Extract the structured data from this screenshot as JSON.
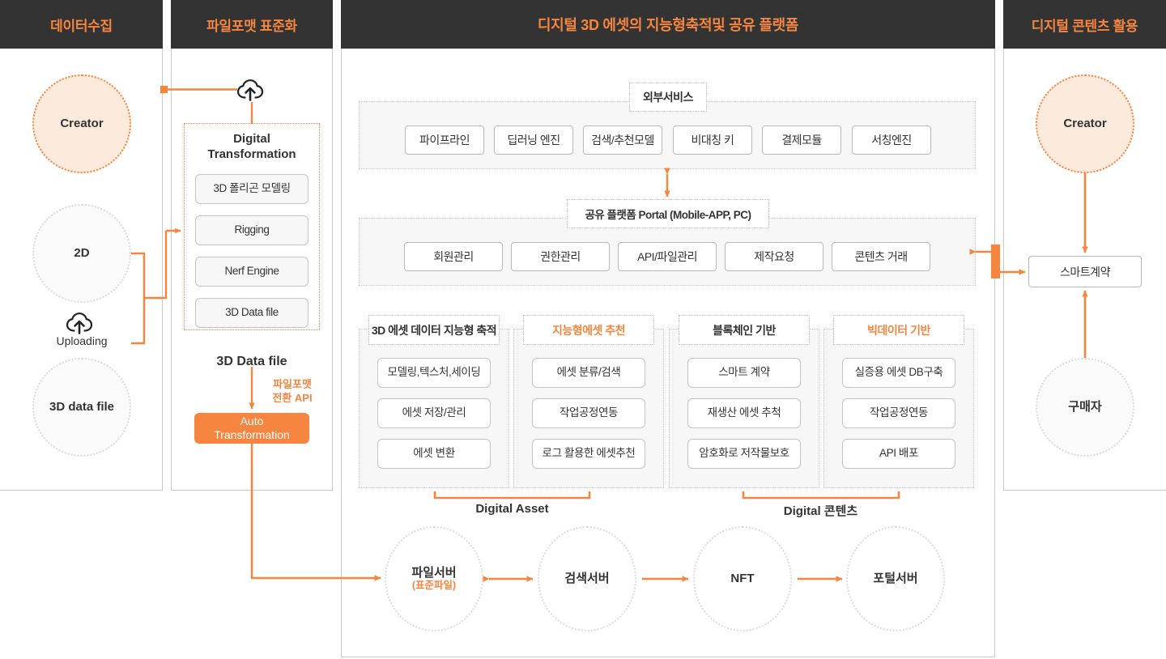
{
  "columns": {
    "collect": {
      "title": "데이터수집"
    },
    "standard": {
      "title": "파일포맷 표준화"
    },
    "platform": {
      "title": "디지털 3D 에셋의 지능형축적및 공유 플랫폼"
    },
    "utilize": {
      "title": "디지털 콘텐츠 활용"
    }
  },
  "collect": {
    "creator": "Creator",
    "twod": "2D",
    "upload_label": "Uploading",
    "threed": "3D data file"
  },
  "standard": {
    "dt_title_line1": "Digital",
    "dt_title_line2": "Transformation",
    "dt_items": [
      "3D 폴리곤 모델링",
      "Rigging",
      "Nerf Engine",
      "3D Data file"
    ],
    "datafile_label": "3D Data file",
    "api_label_line1": "파일포맷",
    "api_label_line2": "전환 API",
    "auto_line1": "Auto",
    "auto_line2": "Transformation"
  },
  "platform": {
    "external": {
      "title": "외부서비스",
      "items": [
        "파이프라인",
        "딥러닝 엔진",
        "검색/추천모델",
        "비대칭 키",
        "결제모듈",
        "서칭엔진"
      ]
    },
    "portal": {
      "title": "공유 플랫폼 Portal (Mobile-APP, PC)",
      "items": [
        "회원관리",
        "권한관리",
        "API/파일관리",
        "제작요청",
        "콘텐츠 거래"
      ]
    },
    "groups": [
      {
        "title": "3D 에셋 데이터 지능형 축적",
        "accent": false,
        "items": [
          "모델링,텍스처,세이딩",
          "에셋 저장/관리",
          "에셋 변환"
        ]
      },
      {
        "title": "지능형에셋 추천",
        "accent": true,
        "items": [
          "에셋 분류/검색",
          "작업공정연동",
          "로그 활용한 에셋추천"
        ]
      },
      {
        "title": "블록체인 기반",
        "accent": false,
        "items": [
          "스마트 계약",
          "재생산 에셋 추척",
          "암호화로 저작물보호"
        ]
      },
      {
        "title": "빅데이터 기반",
        "accent": true,
        "items": [
          "실증용 에셋 DB구축",
          "작업공정연동",
          "API 배포"
        ]
      }
    ],
    "brackets": [
      {
        "label": "Digital Asset"
      },
      {
        "label": "Digital 콘텐츠"
      }
    ],
    "servers": [
      {
        "label": "파일서버",
        "sub": "(표준파일)"
      },
      {
        "label": "검색서버",
        "sub": ""
      },
      {
        "label": "NFT",
        "sub": ""
      },
      {
        "label": "포털서버",
        "sub": ""
      }
    ]
  },
  "utilize": {
    "creator": "Creator",
    "contract": "스마트계약",
    "buyer": "구매자"
  },
  "colors": {
    "accent": "#F5853F",
    "header_bg": "#333333",
    "circle_orange_fill": "#FCEADC",
    "chip_bg": "#F7F7F7",
    "border_grey": "#C4C4C4"
  },
  "icons": {
    "cloud_upload_std": "cloud-upload-icon",
    "cloud_upload_collect": "cloud-upload-icon"
  }
}
